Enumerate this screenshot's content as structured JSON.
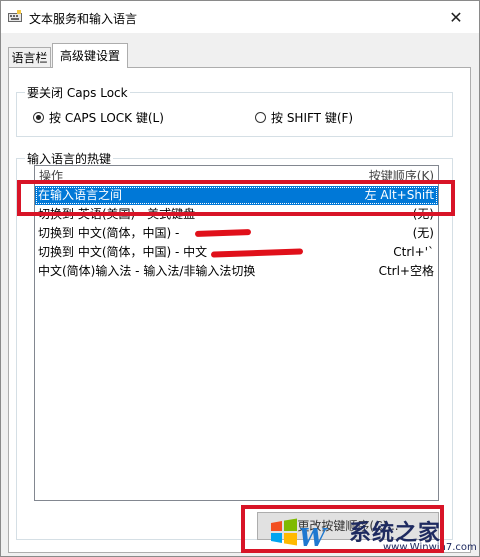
{
  "window": {
    "title": "文本服务和输入语言",
    "close_glyph": "✕"
  },
  "tabs": [
    {
      "label": "语言栏",
      "active": false
    },
    {
      "label": "高级键设置",
      "active": true
    }
  ],
  "caps_group": {
    "legend": "要关闭 Caps Lock",
    "options": [
      {
        "label": "按 CAPS LOCK 键(L)",
        "selected": true
      },
      {
        "label": "按 SHIFT 键(F)",
        "selected": false
      }
    ]
  },
  "hotkeys_group": {
    "legend": "输入语言的热键",
    "columns": {
      "operation": "操作",
      "keys": "按键顺序(K)"
    },
    "rows": [
      {
        "operation": "在输入语言之间",
        "keys": "左 Alt+Shift",
        "selected": true
      },
      {
        "operation": "切换到 英语(美国) - 美式键盘",
        "keys": "(无)",
        "selected": false
      },
      {
        "operation": "切换到 中文(简体，中国) -",
        "keys": "(无)",
        "selected": false
      },
      {
        "operation": "切换到 中文(简体，中国) - 中文",
        "keys": "Ctrl+'`",
        "selected": false
      },
      {
        "operation": "中文(简体)输入法 - 输入法/非输入法切换",
        "keys": "Ctrl+空格",
        "selected": false
      }
    ],
    "change_button_label": "更改按键顺序(C)..."
  },
  "watermark": {
    "text": "系统之家",
    "url": "www.Winwin7.com",
    "logo": "W"
  },
  "colors": {
    "selection": "#0078d7",
    "highlight_box": "#d81427",
    "redaction": "#e0101a"
  },
  "icons": {
    "app": "keyboard-settings-icon",
    "close": "close-icon"
  }
}
